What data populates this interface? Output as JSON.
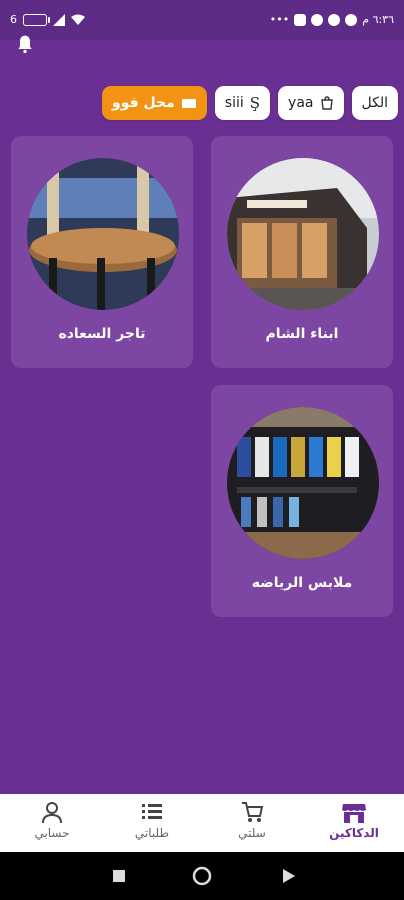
{
  "status_bar": {
    "time": "٦:٣٦ م",
    "dots": "•••",
    "left_text": "6"
  },
  "filters": [
    {
      "label": "الكل",
      "icon": "none",
      "active": false
    },
    {
      "label": "yaa",
      "icon": "shopping-bag-icon",
      "active": false
    },
    {
      "label": "siii",
      "icon": "s-logo-icon",
      "active": false
    },
    {
      "label": "محل فوو",
      "icon": "store-icon",
      "active": true
    }
  ],
  "stores": [
    {
      "name": "ابناء الشام",
      "image": "modern-building-storefront"
    },
    {
      "name": "تاجر السعاده",
      "image": "restaurant-interior"
    },
    {
      "name": "ملابس الرياضه",
      "image": "sports-jerseys-shelves"
    }
  ],
  "bottom_nav": [
    {
      "label": "الدكاكين",
      "icon": "store-icon",
      "active": true
    },
    {
      "label": "سلتي",
      "icon": "cart-icon",
      "active": false
    },
    {
      "label": "طلباتي",
      "icon": "list-icon",
      "active": false
    },
    {
      "label": "حسابي",
      "icon": "user-icon",
      "active": false
    }
  ],
  "colors": {
    "primary": "#6a2f92",
    "card": "#7c46a2",
    "accent": "#f39314"
  }
}
